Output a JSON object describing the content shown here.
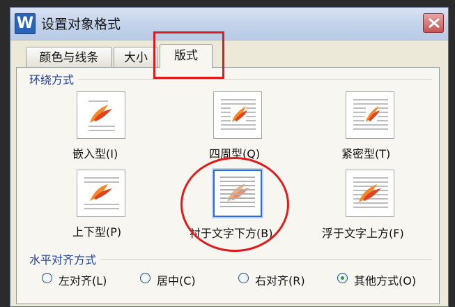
{
  "dialog": {
    "app_icon": "W",
    "title": "设置对象格式",
    "close_icon": "close-icon"
  },
  "tabs": [
    {
      "label": "颜色与线条"
    },
    {
      "label": "大小"
    },
    {
      "label": "版式"
    }
  ],
  "wrap_section": {
    "label": "环绕方式",
    "options": [
      {
        "label": "嵌入型(I)"
      },
      {
        "label": "四周型(Q)"
      },
      {
        "label": "紧密型(T)"
      },
      {
        "label": "上下型(P)"
      },
      {
        "label": "衬于文字下方(B)"
      },
      {
        "label": "浮于文字上方(F)"
      }
    ]
  },
  "align_section": {
    "label": "水平对齐方式",
    "options": [
      {
        "label": "左对齐(L)"
      },
      {
        "label": "居中(C)"
      },
      {
        "label": "右对齐(R)"
      },
      {
        "label": "其他方式(O)"
      }
    ]
  },
  "colors": {
    "annotation": "#e11a1a",
    "section_label": "#1e3fa6",
    "selection": "#2e6bd6"
  }
}
